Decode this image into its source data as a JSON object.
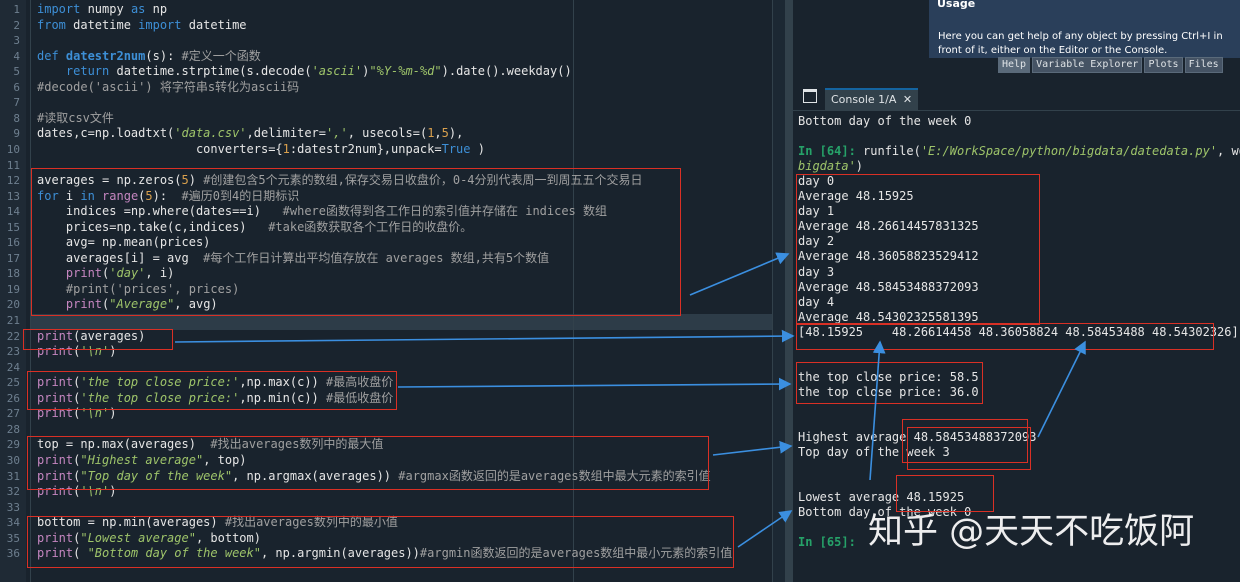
{
  "editor": {
    "lines": [
      {
        "n": "1",
        "segs": [
          [
            "kw",
            "import"
          ],
          [
            "",
            "numpy "
          ],
          [
            "kw",
            "as"
          ],
          [
            "",
            "np"
          ]
        ]
      },
      {
        "n": "2",
        "segs": [
          [
            "kw",
            "from"
          ],
          [
            "",
            "datetime "
          ],
          [
            "kw",
            "import"
          ],
          [
            "",
            "datetime"
          ]
        ]
      },
      {
        "n": "3",
        "segs": []
      },
      {
        "n": "4",
        "segs": [
          [
            "kw",
            "def "
          ],
          [
            "fn",
            "datestr2num"
          ],
          [
            "",
            "(s): "
          ],
          [
            "cm",
            "#定义一个函数"
          ]
        ]
      },
      {
        "n": "5",
        "segs": [
          [
            "",
            "    "
          ],
          [
            "kw",
            "return"
          ],
          [
            "",
            "datetime.strptime(s.decode("
          ],
          [
            "str",
            "'ascii'"
          ],
          [
            "",
            ")"
          ],
          [
            "str",
            "\"%Y-%m-%d\""
          ],
          [
            "",
            ").date().weekday()"
          ]
        ]
      },
      {
        "n": "6",
        "segs": [
          [
            "cm",
            "#decode('ascii') 将字符串s转化为ascii码"
          ]
        ]
      },
      {
        "n": "7",
        "segs": []
      },
      {
        "n": "8",
        "segs": [
          [
            "cm",
            "#读取csv文件"
          ]
        ]
      },
      {
        "n": "9",
        "segs": [
          [
            "",
            "dates,c=np.loadtxt("
          ],
          [
            "str",
            "'data.csv'"
          ],
          [
            "",
            ",delimiter="
          ],
          [
            "str",
            "','"
          ],
          [
            "",
            ", usecols=("
          ],
          [
            "num",
            "1"
          ],
          [
            "",
            ","
          ],
          [
            "num",
            "5"
          ],
          [
            "",
            "),"
          ]
        ]
      },
      {
        "n": "10",
        "segs": [
          [
            "",
            "                      converters={"
          ],
          [
            "num",
            "1"
          ],
          [
            "",
            ":datestr2num},unpack="
          ],
          [
            "kw",
            "True"
          ],
          [
            "",
            ")"
          ]
        ]
      },
      {
        "n": "11",
        "segs": []
      },
      {
        "n": "12",
        "segs": [
          [
            "",
            "averages = np.zeros("
          ],
          [
            "num",
            "5"
          ],
          [
            "",
            ") "
          ],
          [
            "cm",
            "#创建包含5个元素的数组,保存交易日收盘价，0-4分别代表周一到周五五个交易日"
          ]
        ]
      },
      {
        "n": "13",
        "segs": [
          [
            "kw",
            "for"
          ],
          [
            "",
            "i "
          ],
          [
            "kw",
            "in"
          ],
          [
            "builtin",
            "range"
          ],
          [
            "",
            "("
          ],
          [
            "num",
            "5"
          ],
          [
            "",
            "):  "
          ],
          [
            "cm",
            "#遍历0到4的日期标识"
          ]
        ]
      },
      {
        "n": "14",
        "segs": [
          [
            "",
            "    indices =np.where(dates==i)   "
          ],
          [
            "cm",
            "#where函数得到各工作日的索引值并存储在 indices 数组"
          ]
        ]
      },
      {
        "n": "15",
        "segs": [
          [
            "",
            "    prices=np.take(c,indices)   "
          ],
          [
            "cm",
            "#take函数获取各个工作日的收盘价。"
          ]
        ]
      },
      {
        "n": "16",
        "segs": [
          [
            "",
            "    avg= np.mean(prices)"
          ]
        ]
      },
      {
        "n": "17",
        "segs": [
          [
            "",
            "    averages[i] = avg  "
          ],
          [
            "cm",
            "#每个工作日计算出平均值存放在 averages 数组,共有5个数值"
          ]
        ]
      },
      {
        "n": "18",
        "segs": [
          [
            "",
            "    "
          ],
          [
            "builtin",
            "print"
          ],
          [
            "",
            "("
          ],
          [
            "str",
            "'day'"
          ],
          [
            "",
            ", i)"
          ]
        ]
      },
      {
        "n": "19",
        "segs": [
          [
            "cm",
            "    #print('prices', prices)"
          ]
        ]
      },
      {
        "n": "20",
        "segs": [
          [
            "",
            "    "
          ],
          [
            "builtin",
            "print"
          ],
          [
            "",
            "("
          ],
          [
            "str",
            "\"Average\""
          ],
          [
            "",
            ", avg)"
          ]
        ]
      },
      {
        "n": "21",
        "segs": []
      },
      {
        "n": "22",
        "segs": [
          [
            "builtin",
            "print"
          ],
          [
            "",
            "(averages)"
          ]
        ]
      },
      {
        "n": "23",
        "segs": [
          [
            "builtin",
            "print"
          ],
          [
            "",
            "("
          ],
          [
            "str",
            "'\\n'"
          ],
          [
            "",
            ")"
          ]
        ]
      },
      {
        "n": "24",
        "segs": []
      },
      {
        "n": "25",
        "segs": [
          [
            "builtin",
            "print"
          ],
          [
            "",
            "("
          ],
          [
            "str",
            "'the top close price:'"
          ],
          [
            "",
            ",np.max(c)) "
          ],
          [
            "cm",
            "#最高收盘价"
          ]
        ]
      },
      {
        "n": "26",
        "segs": [
          [
            "builtin",
            "print"
          ],
          [
            "",
            "("
          ],
          [
            "str",
            "'the top close price:'"
          ],
          [
            "",
            ",np.min(c)) "
          ],
          [
            "cm",
            "#最低收盘价"
          ]
        ]
      },
      {
        "n": "27",
        "segs": [
          [
            "builtin",
            "print"
          ],
          [
            "",
            "("
          ],
          [
            "str",
            "'\\n'"
          ],
          [
            "",
            ")"
          ]
        ]
      },
      {
        "n": "28",
        "segs": []
      },
      {
        "n": "29",
        "segs": [
          [
            "",
            "top = np.max(averages)  "
          ],
          [
            "cm",
            "#找出averages数列中的最大值"
          ]
        ]
      },
      {
        "n": "30",
        "segs": [
          [
            "builtin",
            "print"
          ],
          [
            "",
            "("
          ],
          [
            "str",
            "\"Highest average\""
          ],
          [
            "",
            ", top)"
          ]
        ]
      },
      {
        "n": "31",
        "segs": [
          [
            "builtin",
            "print"
          ],
          [
            "",
            "("
          ],
          [
            "str",
            "\"Top day of the week\""
          ],
          [
            "",
            ", np.argmax(averages)) "
          ],
          [
            "cm",
            "#argmax函数返回的是averages数组中最大元素的索引值"
          ]
        ]
      },
      {
        "n": "32",
        "segs": [
          [
            "builtin",
            "print"
          ],
          [
            "",
            "("
          ],
          [
            "str",
            "'\\n'"
          ],
          [
            "",
            ")"
          ]
        ]
      },
      {
        "n": "33",
        "segs": []
      },
      {
        "n": "34",
        "segs": [
          [
            "",
            "bottom = np.min(averages) "
          ],
          [
            "cm",
            "#找出averages数列中的最小值"
          ]
        ]
      },
      {
        "n": "35",
        "segs": [
          [
            "builtin",
            "print"
          ],
          [
            "",
            "("
          ],
          [
            "str",
            "\"Lowest average\""
          ],
          [
            "",
            ", bottom)"
          ]
        ]
      },
      {
        "n": "36",
        "segs": [
          [
            "builtin",
            "print"
          ],
          [
            "",
            "( "
          ],
          [
            "str",
            "\"Bottom day of the week\""
          ],
          [
            "",
            ", np.argmin(averages))"
          ],
          [
            "cm",
            "#argmin函数返回的是averages数组中最小元素的索引值"
          ]
        ]
      }
    ]
  },
  "help": {
    "title": "Usage",
    "text": "Here you can get help of any object by pressing Ctrl+I in front of it, either on the Editor or the Console.",
    "tabs": [
      "Help",
      "Variable Explorer",
      "Plots",
      "Files"
    ]
  },
  "console": {
    "tab_label": "Console 1/A",
    "lines": [
      {
        "segs": [
          [
            "",
            "Bottom day of the week 0"
          ]
        ]
      },
      {
        "segs": []
      },
      {
        "segs": [
          [
            "prompt",
            "In [64]: "
          ],
          [
            "",
            "runfile("
          ],
          [
            "cstr",
            "'E:/WorkSpace/python/bigdata/datedata.py'"
          ],
          [
            "",
            ", wdir="
          ]
        ]
      },
      {
        "segs": [
          [
            "cstr",
            "bigdata'"
          ],
          [
            "",
            ")"
          ]
        ]
      },
      {
        "segs": [
          [
            "",
            "day 0"
          ]
        ]
      },
      {
        "segs": [
          [
            "",
            "Average 48.15925"
          ]
        ]
      },
      {
        "segs": [
          [
            "",
            "day 1"
          ]
        ]
      },
      {
        "segs": [
          [
            "",
            "Average 48.26614457831325"
          ]
        ]
      },
      {
        "segs": [
          [
            "",
            "day 2"
          ]
        ]
      },
      {
        "segs": [
          [
            "",
            "Average 48.36058823529412"
          ]
        ]
      },
      {
        "segs": [
          [
            "",
            "day 3"
          ]
        ]
      },
      {
        "segs": [
          [
            "",
            "Average 48.58453488372093"
          ]
        ]
      },
      {
        "segs": [
          [
            "",
            "day 4"
          ]
        ]
      },
      {
        "segs": [
          [
            "",
            "Average 48.54302325581395"
          ]
        ]
      },
      {
        "segs": [
          [
            "",
            "[48.15925    48.26614458 48.36058824 48.58453488 48.54302326]"
          ]
        ]
      },
      {
        "segs": []
      },
      {
        "segs": []
      },
      {
        "segs": [
          [
            "",
            "the top close price: 58.5"
          ]
        ]
      },
      {
        "segs": [
          [
            "",
            "the top close price: 36.0"
          ]
        ]
      },
      {
        "segs": []
      },
      {
        "segs": []
      },
      {
        "segs": [
          [
            "",
            "Highest average 48.58453488372093"
          ]
        ]
      },
      {
        "segs": [
          [
            "",
            "Top day of the week 3"
          ]
        ]
      },
      {
        "segs": []
      },
      {
        "segs": []
      },
      {
        "segs": [
          [
            "",
            "Lowest average 48.15925"
          ]
        ]
      },
      {
        "segs": [
          [
            "",
            "Bottom day of the week 0"
          ]
        ]
      },
      {
        "segs": []
      },
      {
        "segs": [
          [
            "prompt",
            "In [65]: "
          ]
        ]
      }
    ]
  },
  "watermark": "知乎 @天天不吃饭阿"
}
